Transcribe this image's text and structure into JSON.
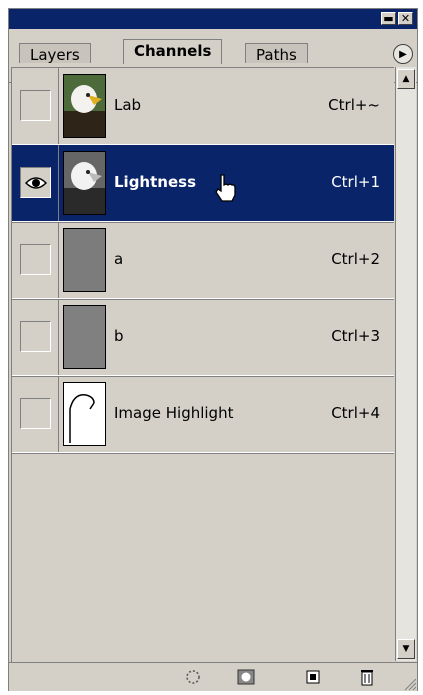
{
  "tabs": [
    {
      "label": "Layers",
      "active": false
    },
    {
      "label": "Channels",
      "active": true
    },
    {
      "label": "Paths",
      "active": false
    }
  ],
  "window_buttons": {
    "minimize": "minimize-icon",
    "close": "close-icon"
  },
  "channels": [
    {
      "name": "Lab",
      "shortcut": "Ctrl+~",
      "visible": false,
      "selected": false,
      "thumb": "color-eagle"
    },
    {
      "name": "Lightness",
      "shortcut": "Ctrl+1",
      "visible": true,
      "selected": true,
      "thumb": "gray-eagle"
    },
    {
      "name": "a",
      "shortcut": "Ctrl+2",
      "visible": false,
      "selected": false,
      "thumb": "flat-gray"
    },
    {
      "name": "b",
      "shortcut": "Ctrl+3",
      "visible": false,
      "selected": false,
      "thumb": "flat-gray"
    },
    {
      "name": "Image Highlight",
      "shortcut": "Ctrl+4",
      "visible": false,
      "selected": false,
      "thumb": "mask"
    }
  ],
  "bottom_icons": [
    "load-selection-icon",
    "save-selection-icon",
    "new-channel-icon",
    "trash-icon"
  ],
  "colors": {
    "selection": "#0a246a",
    "panel": "#d4d0c8"
  }
}
